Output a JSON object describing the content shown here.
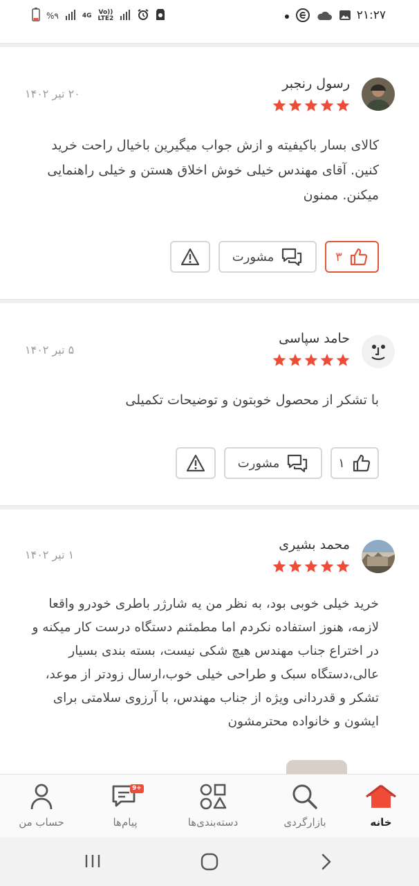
{
  "status_bar": {
    "time": "۲۱:۲۷",
    "battery_percent": "%۹",
    "network_label_top": "4G",
    "network_label_bottom": "LTE2",
    "volte": "Vo))"
  },
  "reviews": [
    {
      "author": "رسول رنجبر",
      "date": "۲۰ تیر ۱۴۰۲",
      "rating": 5,
      "text": "کالای بسار باکیفیته و ازش جواب میگیرین باخیال راحت خرید کنین. آقای مهندس خیلی خوش اخلاق هستن و خیلی راهنمایی میکنن. ممنون",
      "likes": "۳",
      "liked": true,
      "consult_label": "مشورت"
    },
    {
      "author": "حامد سپاسی",
      "date": "۵ تیر ۱۴۰۲",
      "rating": 5,
      "text": "با تشکر از محصول خوبتون و توضیحات تکمیلی",
      "likes": "۱",
      "liked": false,
      "consult_label": "مشورت"
    },
    {
      "author": "محمد بشیری",
      "date": "۱ تیر ۱۴۰۲",
      "rating": 5,
      "text": "خرید خیلی خوبی بود، به نظر من یه شارژر باطری خودرو واقعا لازمه، هنوز استفاده نکردم اما مطمئنم دستگاه درست کار میکنه و در اختراع جناب مهندس هیچ شکی نیست، بسته بندی بسیار عالی،دستگاه سبک و طراحی خیلی خوب،ارسال زودتر از موعد، تشکر و قدردانی ویژه از جناب مهندس، با آرزوی سلامتی برای ایشون و خانواده محترمشون"
    }
  ],
  "bottom_nav": {
    "home": "خانه",
    "browse": "بازارگردی",
    "categories": "دسته‌بندی‌ها",
    "messages": "پیام‌ها",
    "messages_badge": "9+",
    "account": "حساب من"
  },
  "colors": {
    "accent": "#e4533a",
    "star": "#ef4b37",
    "text": "#444444",
    "muted": "#9a9a9a"
  }
}
